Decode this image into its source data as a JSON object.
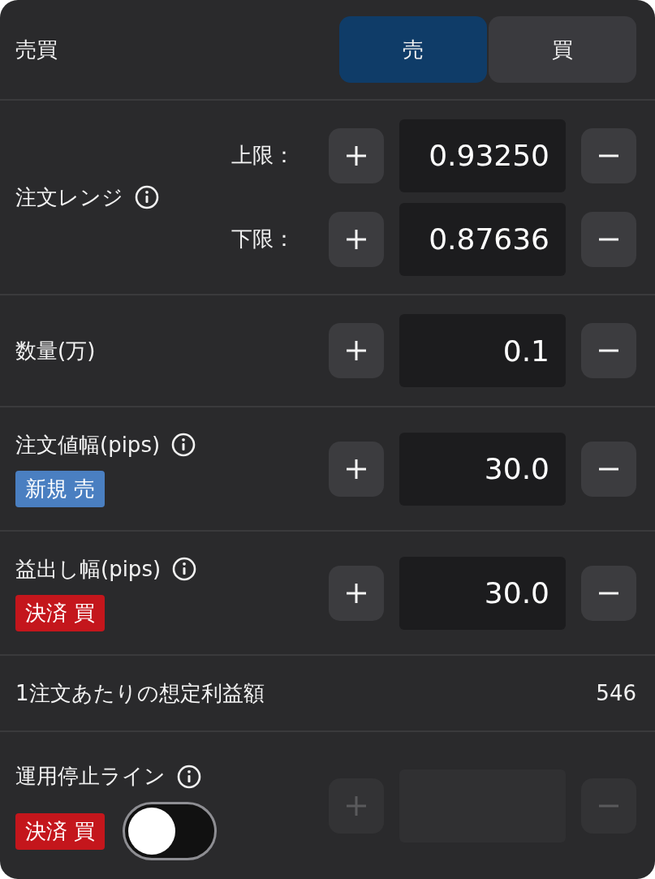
{
  "trade_side": {
    "label": "売買",
    "options": [
      {
        "label": "売",
        "selected": true
      },
      {
        "label": "買",
        "selected": false
      }
    ]
  },
  "sections": [
    {
      "kind": "range",
      "label": "注文レンジ",
      "info": true,
      "limits": [
        {
          "label": "上限：",
          "value": "0.93250"
        },
        {
          "label": "下限：",
          "value": "0.87636"
        }
      ]
    },
    {
      "kind": "stepper",
      "label": "数量(万)",
      "info": false,
      "value": "0.1",
      "disabled": false
    },
    {
      "kind": "stepper",
      "label": "注文値幅(pips)",
      "info": true,
      "badge": {
        "text": "新規 売",
        "color": "#4a7fc1"
      },
      "value": "30.0",
      "disabled": false
    },
    {
      "kind": "stepper",
      "label": "益出し幅(pips)",
      "info": true,
      "badge": {
        "text": "決済 買",
        "color": "#c4161c"
      },
      "value": "30.0",
      "disabled": false
    },
    {
      "kind": "value",
      "label": "1注文あたりの想定利益額",
      "value": "546"
    },
    {
      "kind": "stepper",
      "label": "運用停止ライン",
      "info": true,
      "badge": {
        "text": "決済 買",
        "color": "#c4161c"
      },
      "toggle": {
        "on": false
      },
      "disabled": true
    }
  ]
}
